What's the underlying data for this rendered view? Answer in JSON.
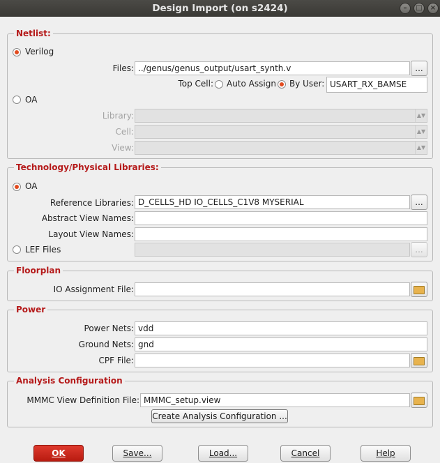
{
  "window": {
    "title": "Design Import (on s2424)"
  },
  "netlist": {
    "group_label": "Netlist:",
    "verilog_label": "Verilog",
    "files_label": "Files:",
    "files_value": "../genus/genus_output/usart_synth.v",
    "browse_label": "...",
    "topcell_label": "Top Cell:",
    "auto_assign_label": "Auto Assign",
    "by_user_label": "By User:",
    "top_cell_value": "USART_RX_BAMSE",
    "oa_label": "OA",
    "library_label": "Library:",
    "cell_label": "Cell:",
    "view_label": "View:"
  },
  "tech": {
    "group_label": "Technology/Physical Libraries:",
    "oa_label": "OA",
    "ref_libs_label": "Reference Libraries:",
    "ref_libs_value": "D_CELLS_HD IO_CELLS_C1V8 MYSERIAL",
    "browse_label": "...",
    "abstract_label": "Abstract View Names:",
    "abstract_value": "",
    "layout_label": "Layout View Names:",
    "layout_value": "",
    "lef_label": "LEF Files",
    "lef_browse_label": "..."
  },
  "floorplan": {
    "group_label": "Floorplan",
    "io_label": "IO Assignment File:",
    "io_value": ""
  },
  "power": {
    "group_label": "Power",
    "power_nets_label": "Power Nets:",
    "power_nets_value": "vdd",
    "ground_nets_label": "Ground Nets:",
    "ground_nets_value": "gnd",
    "cpf_label": "CPF File:",
    "cpf_value": ""
  },
  "analysis": {
    "group_label": "Analysis Configuration",
    "mmmc_label": "MMMC View Definition File:",
    "mmmc_value": "MMMC_setup.view",
    "create_button": "Create Analysis Configuration ..."
  },
  "buttons": {
    "ok": "OK",
    "save": "Save...",
    "load": "Load...",
    "cancel": "Cancel",
    "help": "Help"
  },
  "colors": {
    "accent": "#b51a1a",
    "ok_button": "#c8251a",
    "radio_selected": "#e24b1f"
  }
}
